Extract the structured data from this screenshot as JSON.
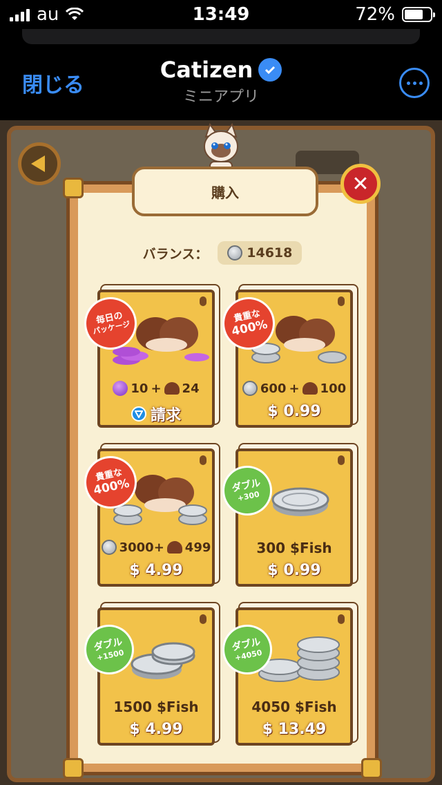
{
  "status_bar": {
    "carrier": "au",
    "time": "13:49",
    "battery_percent": "72%",
    "battery_level": 0.72
  },
  "header": {
    "close_label": "閉じる",
    "app_title": "Catizen",
    "subtitle": "ミニアプリ"
  },
  "modal": {
    "title": "購入",
    "close_symbol": "✕",
    "balance_label": "バランス：",
    "balance_value": "14618"
  },
  "cards": [
    {
      "badge_line1": "毎日の",
      "badge_line2": "パッケージ",
      "amount_a": "10",
      "plus": "+",
      "amount_b": "24",
      "price": "請求"
    },
    {
      "badge_line1": "貴重な",
      "badge_line2": "400%",
      "amount_a": "600",
      "plus": "+",
      "amount_b": "100",
      "price": "$ 0.99"
    },
    {
      "badge_line1": "貴重な",
      "badge_line2": "400%",
      "amount_a": "3000+",
      "amount_b": "499",
      "price": "$ 4.99"
    },
    {
      "badge_line1": "ダブル",
      "badge_line2": "+300",
      "label": "300 $Fish",
      "price": "$ 0.99"
    },
    {
      "badge_line1": "ダブル",
      "badge_line2": "+1500",
      "label": "1500 $Fish",
      "price": "$ 4.99"
    },
    {
      "badge_line1": "ダブル",
      "badge_line2": "+4050",
      "label": "4050 $Fish",
      "price": "$ 13.49"
    }
  ],
  "colors": {
    "accent": "#3a8cf5",
    "frame": "#8a5a2e",
    "card": "#f2c24a",
    "badge_red": "#e5432e",
    "badge_green": "#6cc24a"
  }
}
